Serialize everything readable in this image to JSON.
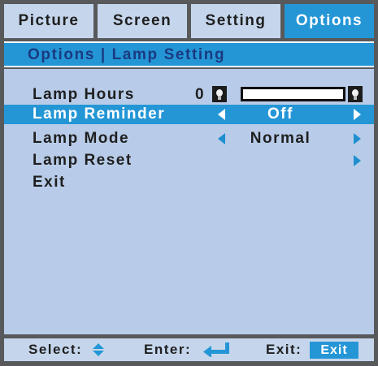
{
  "tabs": [
    {
      "label": "Picture",
      "active": false
    },
    {
      "label": "Screen",
      "active": false
    },
    {
      "label": "Setting",
      "active": false
    },
    {
      "label": "Options",
      "active": true
    }
  ],
  "title": "Options | Lamp Setting",
  "menu": {
    "lamp_hours": {
      "label": "Lamp Hours",
      "value": "0",
      "fill_fraction": 0
    },
    "lamp_reminder": {
      "label": "Lamp Reminder",
      "value": "Off",
      "selected": true
    },
    "lamp_mode": {
      "label": "Lamp Mode",
      "value": "Normal"
    },
    "lamp_reset": {
      "label": "Lamp Reset"
    },
    "exit": {
      "label": "Exit"
    }
  },
  "footer": {
    "select_label": "Select:",
    "enter_label": "Enter:",
    "exit_label": "Exit:",
    "exit_key": "Exit"
  },
  "icons": {
    "lamp": "lamp-bulb-icon",
    "left_arrow": "triangle-left-icon",
    "right_arrow": "triangle-right-icon",
    "select": "up-down-arrows-icon",
    "enter": "enter-return-icon"
  },
  "colors": {
    "frame": "#58595b",
    "accent": "#2496d6",
    "tab_bg": "#c5d6ec",
    "content_bg": "#b8cce9",
    "title_text": "#1a3a80"
  }
}
